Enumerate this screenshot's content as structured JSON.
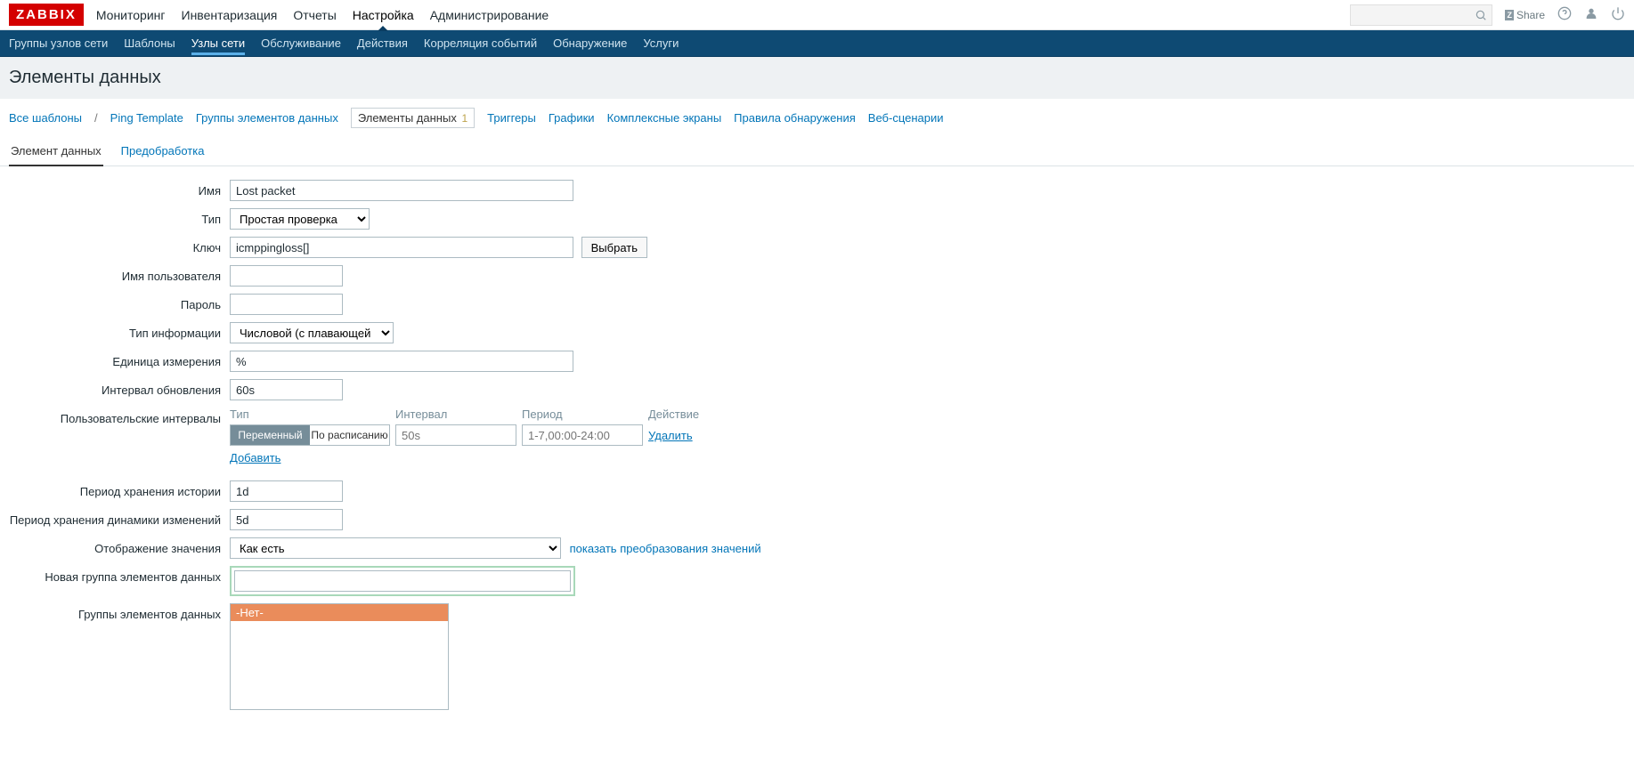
{
  "logo": "ZABBIX",
  "topnav": {
    "items": [
      "Мониторинг",
      "Инвентаризация",
      "Отчеты",
      "Настройка",
      "Администрирование"
    ],
    "active_index": 3
  },
  "topright": {
    "share": "Share"
  },
  "subnav": {
    "items": [
      "Группы узлов сети",
      "Шаблоны",
      "Узлы сети",
      "Обслуживание",
      "Действия",
      "Корреляция событий",
      "Обнаружение",
      "Услуги"
    ],
    "active_index": 2
  },
  "page_title": "Элементы данных",
  "breadcrumb": {
    "all_templates": "Все шаблоны",
    "template": "Ping Template",
    "links": [
      {
        "label": "Группы элементов данных"
      },
      {
        "label": "Элементы данных",
        "count": "1",
        "current": true
      },
      {
        "label": "Триггеры"
      },
      {
        "label": "Графики"
      },
      {
        "label": "Комплексные экраны"
      },
      {
        "label": "Правила обнаружения"
      },
      {
        "label": "Веб-сценарии"
      }
    ]
  },
  "tabs": {
    "items": [
      "Элемент данных",
      "Предобработка"
    ],
    "active_index": 0
  },
  "form": {
    "name": {
      "label": "Имя",
      "value": "Lost packet"
    },
    "type": {
      "label": "Тип",
      "value": "Простая проверка"
    },
    "key": {
      "label": "Ключ",
      "value": "icmppingloss[]",
      "select_btn": "Выбрать"
    },
    "username": {
      "label": "Имя пользователя",
      "value": ""
    },
    "password": {
      "label": "Пароль",
      "value": ""
    },
    "info_type": {
      "label": "Тип информации",
      "value": "Числовой (с плавающей точкой)"
    },
    "units": {
      "label": "Единица измерения",
      "value": "%"
    },
    "update_interval": {
      "label": "Интервал обновления",
      "value": "60s"
    },
    "custom_intervals": {
      "label": "Пользовательские интервалы",
      "headers": {
        "type": "Тип",
        "interval": "Интервал",
        "period": "Период",
        "action": "Действие"
      },
      "row": {
        "seg_flex": "Переменный",
        "seg_sched": "По расписанию",
        "interval_ph": "50s",
        "period_ph": "1-7,00:00-24:00",
        "remove": "Удалить"
      },
      "add": "Добавить"
    },
    "history": {
      "label": "Период хранения истории",
      "value": "1d"
    },
    "trends": {
      "label": "Период хранения динамики изменений",
      "value": "5d"
    },
    "value_map": {
      "label": "Отображение значения",
      "value": "Как есть",
      "link": "показать преобразования значений"
    },
    "new_app": {
      "label": "Новая группа элементов данных",
      "value": ""
    },
    "apps": {
      "label": "Группы элементов данных",
      "selected": "-Нет-"
    }
  }
}
